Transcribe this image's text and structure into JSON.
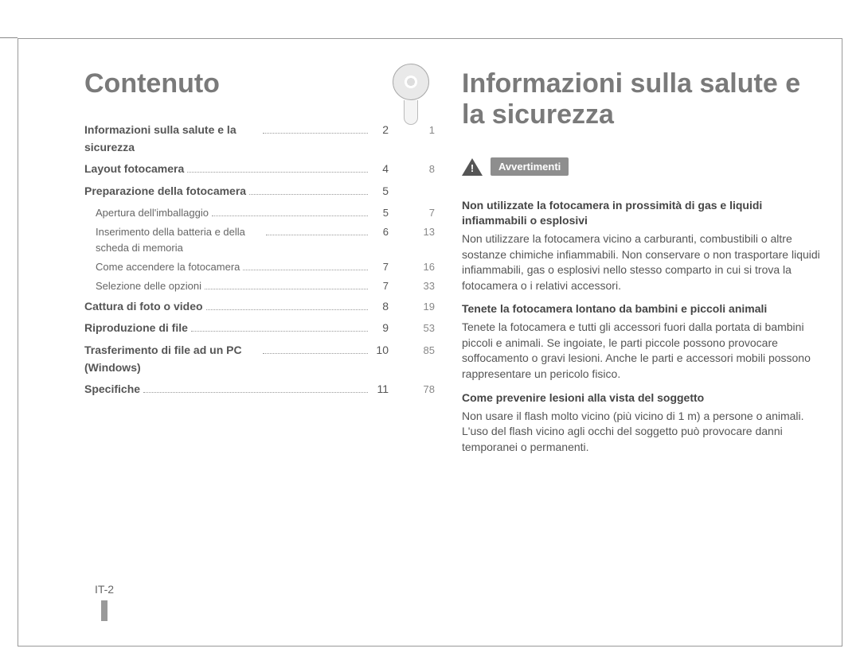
{
  "left": {
    "title": "Contenuto",
    "items": [
      {
        "label": "Informazioni sulla salute e la sicurezza",
        "page": "2",
        "aside": "1",
        "bold": true
      },
      {
        "label": "Layout fotocamera",
        "page": "4",
        "aside": "8",
        "bold": true
      },
      {
        "label": "Preparazione della fotocamera",
        "page": "5",
        "aside": "",
        "bold": true
      },
      {
        "label": "Apertura dell'imballaggio",
        "page": "5",
        "aside": "7",
        "bold": false,
        "sub": true
      },
      {
        "label": "Inserimento della batteria e della scheda di memoria",
        "page": "6",
        "aside": "13",
        "bold": false,
        "sub": true
      },
      {
        "label": "Come accendere la fotocamera",
        "page": "7",
        "aside": "16",
        "bold": false,
        "sub": true
      },
      {
        "label": "Selezione delle opzioni",
        "page": "7",
        "aside": "33",
        "bold": false,
        "sub": true
      },
      {
        "label": "Cattura di foto o video",
        "page": "8",
        "aside": "19",
        "bold": true
      },
      {
        "label": "Riproduzione di file",
        "page": "9",
        "aside": "53",
        "bold": true
      },
      {
        "label": "Trasferimento di file ad un PC (Windows)",
        "page": "10",
        "aside": "85",
        "bold": true
      },
      {
        "label": "Specifiche",
        "page": "11",
        "aside": "78",
        "bold": true
      }
    ],
    "footer": "IT-2"
  },
  "right": {
    "title": "Informazioni sulla salute e la sicurezza",
    "warning_label": "Avvertimenti",
    "sections": [
      {
        "head": "Non utilizzate la fotocamera in prossimità di gas e liquidi infiammabili o esplosivi",
        "body": "Non utilizzare la fotocamera vicino a carburanti, combustibili o altre sostanze chimiche infiammabili. Non conservare o non trasportare liquidi infiammabili, gas o esplosivi nello stesso comparto in cui si trova la fotocamera o i relativi accessori."
      },
      {
        "head": "Tenete la fotocamera lontano da bambini e piccoli animali",
        "body": "Tenete la fotocamera e tutti gli accessori fuori dalla portata di bambini piccoli e animali. Se ingoiate, le parti piccole possono provocare soffocamento o gravi lesioni. Anche le parti e accessori mobili possono rappresentare un pericolo fisico."
      },
      {
        "head": "Come prevenire lesioni alla vista del soggetto",
        "body": "Non usare il flash molto vicino (più vicino di 1 m) a persone o animali. L'uso del flash vicino agli occhi del soggetto può provocare danni temporanei o permanenti."
      }
    ]
  },
  "icons": {
    "cd": "cd-icon",
    "warning": "warning-triangle-icon"
  }
}
